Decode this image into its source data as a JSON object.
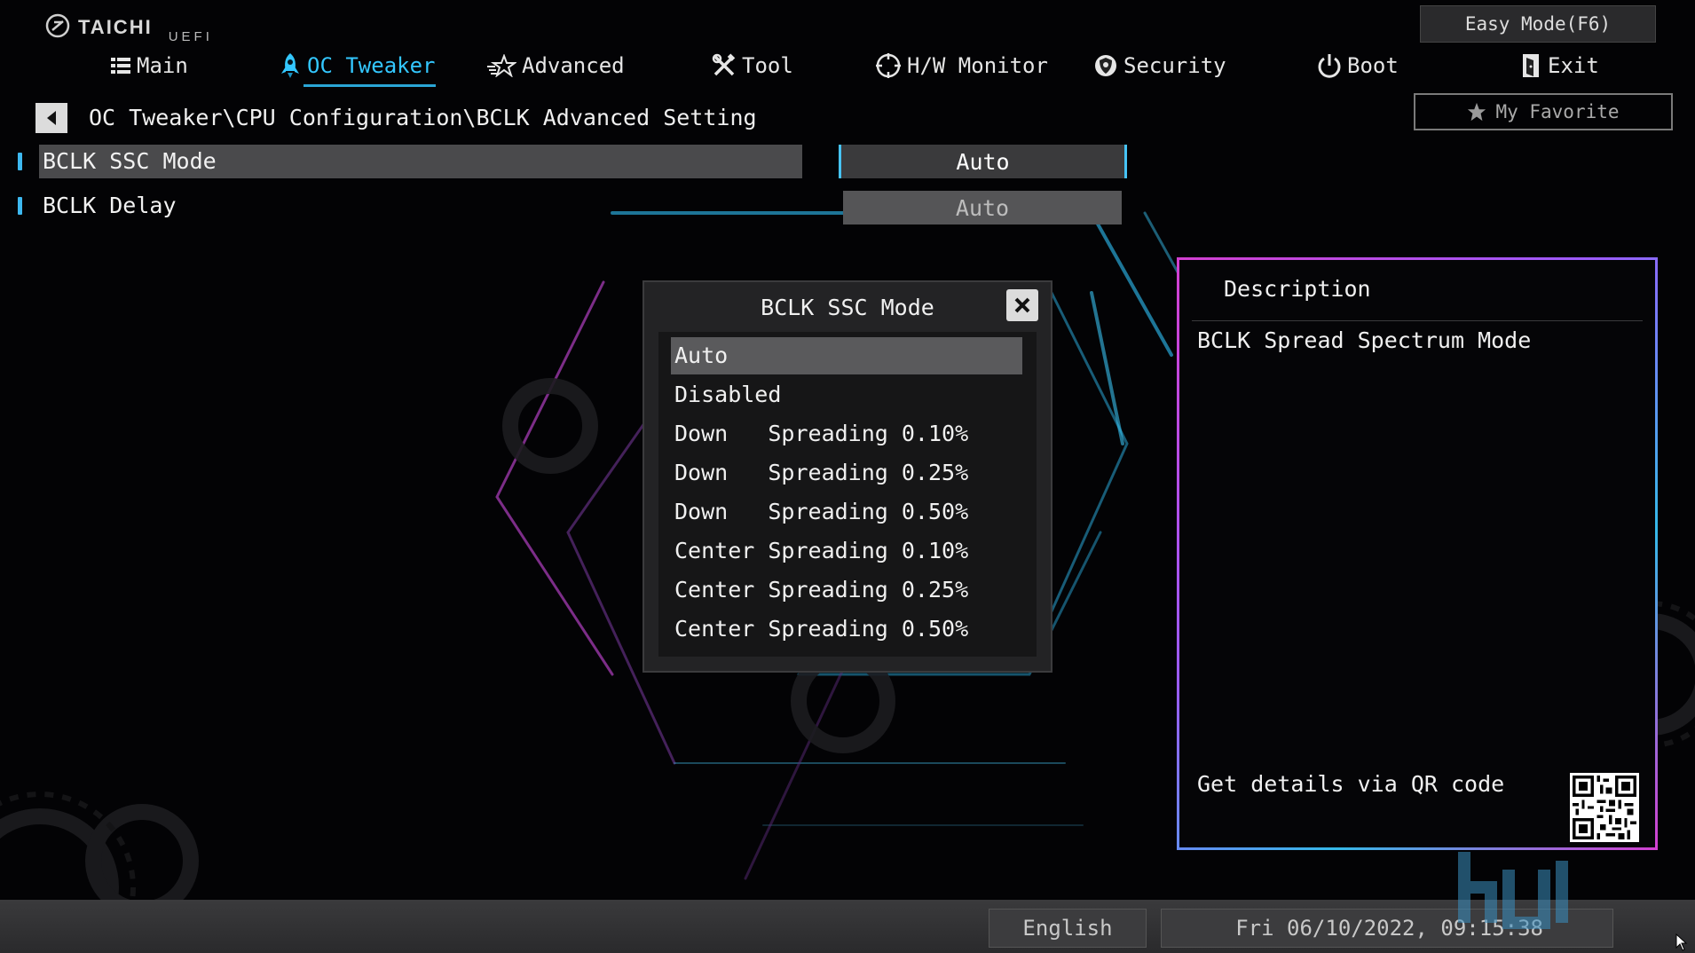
{
  "logo": {
    "brand": "TAICHI",
    "sub": "UEFI"
  },
  "header": {
    "easy_mode": "Easy Mode(F6)",
    "favorite": "My Favorite"
  },
  "nav": [
    {
      "label": "Main",
      "icon": "list-icon",
      "active": false
    },
    {
      "label": "OC Tweaker",
      "icon": "rocket-icon",
      "active": true
    },
    {
      "label": "Advanced",
      "icon": "star-icon",
      "active": false
    },
    {
      "label": "Tool",
      "icon": "tools-icon",
      "active": false
    },
    {
      "label": "H/W Monitor",
      "icon": "monitor-icon",
      "active": false
    },
    {
      "label": "Security",
      "icon": "shield-icon",
      "active": false
    },
    {
      "label": "Boot",
      "icon": "power-icon",
      "active": false
    },
    {
      "label": "Exit",
      "icon": "exit-icon",
      "active": false
    }
  ],
  "breadcrumb": "OC Tweaker\\CPU Configuration\\BCLK Advanced Setting",
  "settings": [
    {
      "label": "BCLK SSC Mode",
      "value": "Auto"
    },
    {
      "label": "BCLK Delay",
      "value": "Auto"
    }
  ],
  "popup": {
    "title": "BCLK SSC Mode",
    "options": [
      "Auto",
      "Disabled",
      "Down   Spreading 0.10%",
      "Down   Spreading 0.25%",
      "Down   Spreading 0.50%",
      "Center Spreading 0.10%",
      "Center Spreading 0.25%",
      "Center Spreading 0.50%"
    ],
    "selected_index": 0
  },
  "description": {
    "title": "Description",
    "text": "BCLK Spread Spectrum Mode",
    "qr_text": "Get details via QR code"
  },
  "footer": {
    "language": "English",
    "datetime": "Fri 06/10/2022, 09:15:38"
  },
  "colors": {
    "accent": "#33c7ff",
    "desc_border": "#d33fd0"
  }
}
